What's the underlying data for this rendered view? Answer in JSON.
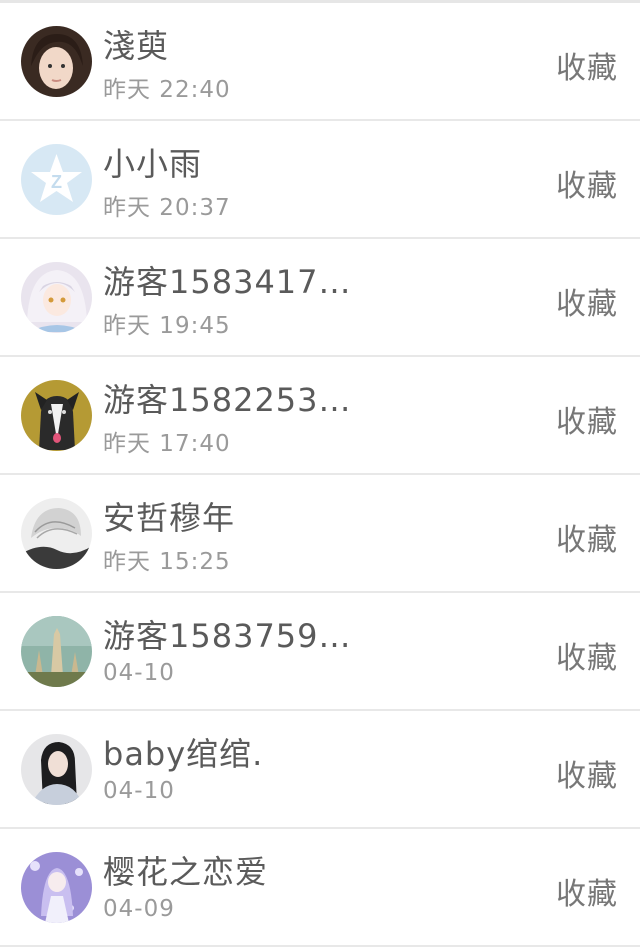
{
  "items": [
    {
      "name": "淺萸",
      "time": "昨天 22:40",
      "action": "收藏",
      "avatar": "photo-avatar-girl"
    },
    {
      "name": "小小雨",
      "time": "昨天 20:37",
      "action": "收藏",
      "avatar": "qzone-default-avatar"
    },
    {
      "name": "游客1583417…",
      "time": "昨天 19:45",
      "action": "收藏",
      "avatar": "anime-avatar-white-hair"
    },
    {
      "name": "游客1582253…",
      "time": "昨天 17:40",
      "action": "收藏",
      "avatar": "dog-avatar"
    },
    {
      "name": "安哲穆年",
      "time": "昨天 15:25",
      "action": "收藏",
      "avatar": "sketch-avatar"
    },
    {
      "name": "游客1583759…",
      "time": "04-10",
      "action": "收藏",
      "avatar": "landscape-avatar"
    },
    {
      "name": "baby绾绾.",
      "time": "04-10",
      "action": "收藏",
      "avatar": "photo-avatar-dark-hair"
    },
    {
      "name": "樱花之恋爱",
      "time": "04-09",
      "action": "收藏",
      "avatar": "anime-avatar-purple"
    }
  ]
}
